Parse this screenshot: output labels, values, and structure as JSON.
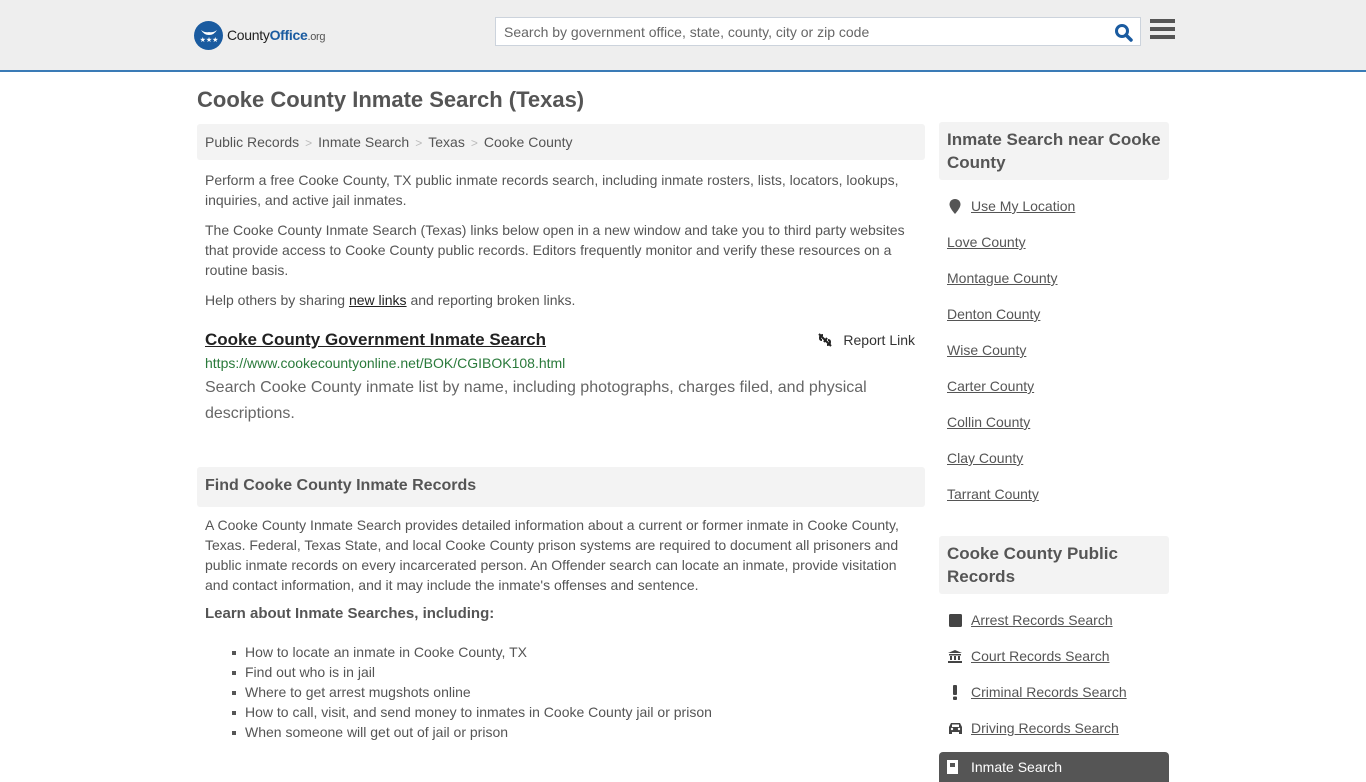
{
  "header": {
    "logo": {
      "county": "County",
      "office": "Office",
      "org": ".org"
    },
    "search_placeholder": "Search by government office, state, county, city or zip code",
    "search_icon": "search-icon",
    "menu_icon": "hamburger-menu-icon"
  },
  "page_title": "Cooke County Inmate Search (Texas)",
  "breadcrumb": [
    "Public Records",
    "Inmate Search",
    "Texas",
    "Cooke County"
  ],
  "intro": {
    "p1": "Perform a free Cooke County, TX public inmate records search, including inmate rosters, lists, locators, lookups, inquiries, and active jail inmates.",
    "p2": "The Cooke County Inmate Search (Texas) links below open in a new window and take you to third party websites that provide access to Cooke County public records. Editors frequently monitor and verify these resources on a routine basis.",
    "p3_before": "Help others by sharing ",
    "p3_link": "new links",
    "p3_after": " and reporting broken links."
  },
  "result": {
    "title": "Cooke County Government Inmate Search",
    "report_label": "Report Link",
    "url": "https://www.cookecountyonline.net/BOK/CGIBOK108.html",
    "description": "Search Cooke County inmate list by name, including photographs, charges filed, and physical descriptions."
  },
  "find_section": {
    "heading": "Find Cooke County Inmate Records",
    "body": "A Cooke County Inmate Search provides detailed information about a current or former inmate in Cooke County, Texas. Federal, Texas State, and local Cooke County prison systems are required to document all prisoners and public inmate records on every incarcerated person. An Offender search can locate an inmate, provide visitation and contact information, and it may include the inmate's offenses and sentence.",
    "learn_heading": "Learn about Inmate Searches, including:",
    "bullets": [
      "How to locate an inmate in Cooke County, TX",
      "Find out who is in jail",
      "Where to get arrest mugshots online",
      "How to call, visit, and send money to inmates in Cooke County jail or prison",
      "When someone will get out of jail or prison"
    ]
  },
  "sidebar": {
    "nearby_heading": "Inmate Search near Cooke County",
    "use_location": "Use My Location",
    "nearby": [
      "Love County",
      "Montague County",
      "Denton County",
      "Wise County",
      "Carter County",
      "Collin County",
      "Clay County",
      "Tarrant County"
    ],
    "public_heading": "Cooke County Public Records",
    "public": [
      {
        "label": "Arrest Records Search",
        "icon": "square-icon"
      },
      {
        "label": "Court Records Search",
        "icon": "courthouse-icon"
      },
      {
        "label": "Criminal Records Search",
        "icon": "exclamation-icon"
      },
      {
        "label": "Driving Records Search",
        "icon": "car-icon"
      }
    ],
    "active": {
      "label": "Inmate Search",
      "icon": "jail-door-icon"
    }
  }
}
